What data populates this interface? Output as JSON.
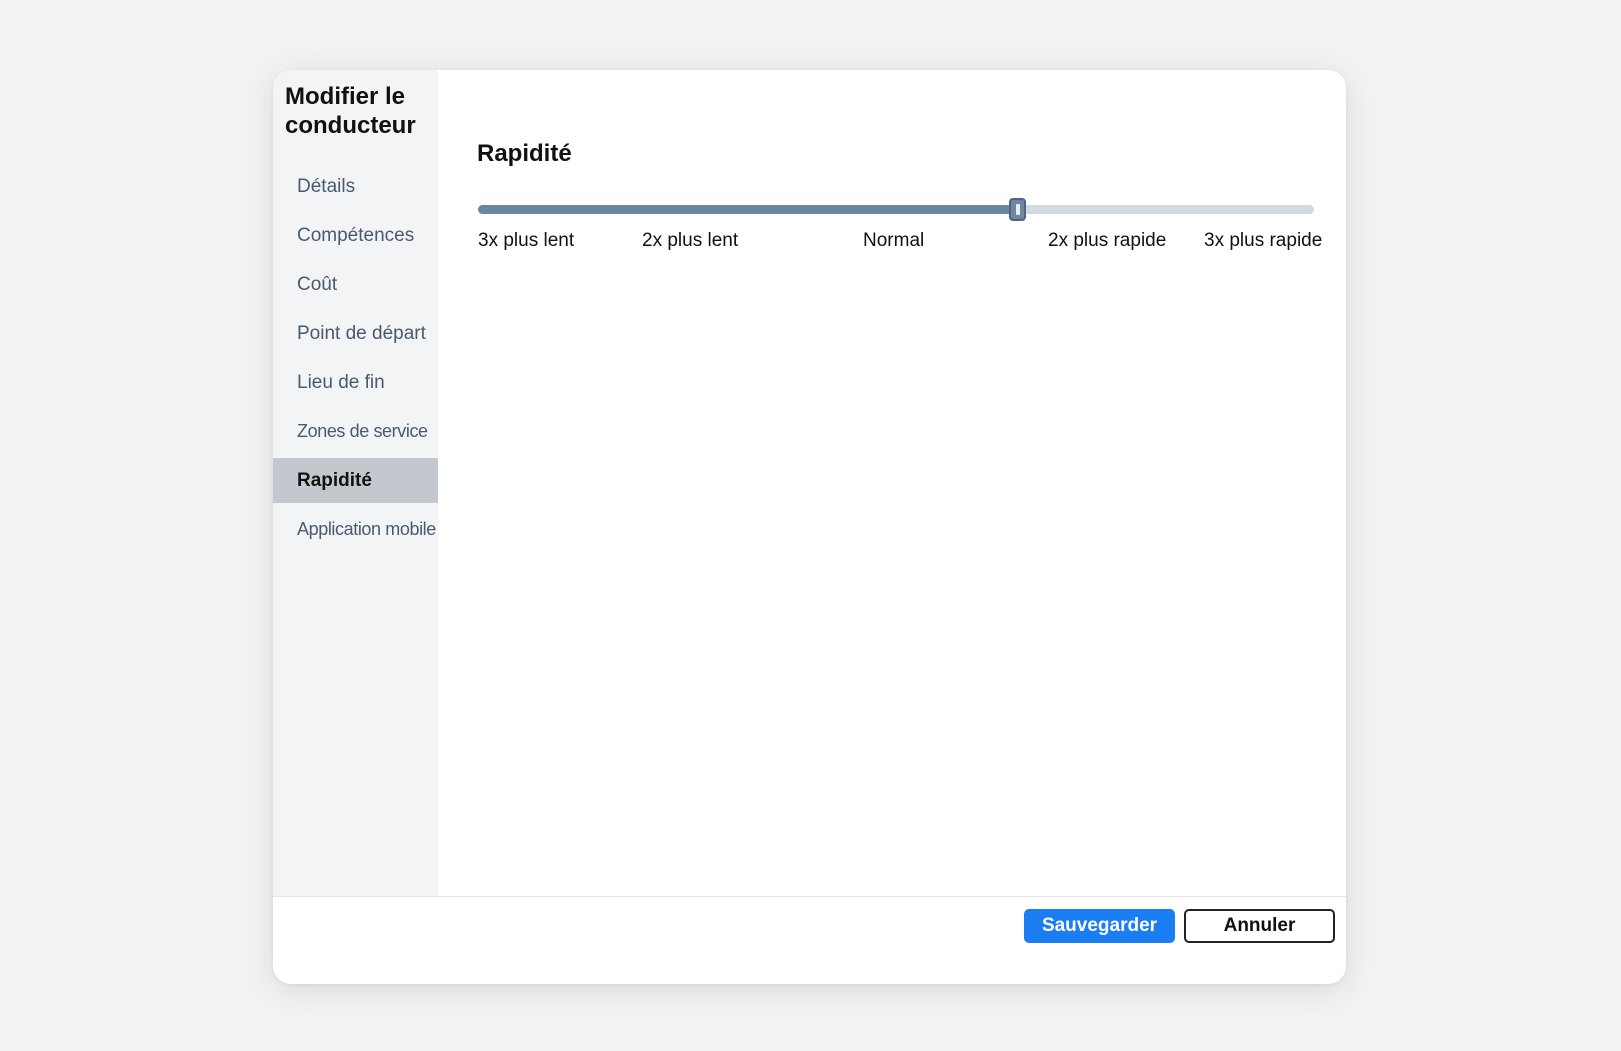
{
  "dialog": {
    "title": "Modifier le conducteur"
  },
  "sidebar": {
    "items": [
      {
        "label": "Détails"
      },
      {
        "label": "Compétences"
      },
      {
        "label": "Coût"
      },
      {
        "label": "Point de départ"
      },
      {
        "label": "Lieu de fin"
      },
      {
        "label": "Zones de service"
      },
      {
        "label": "Rapidité"
      },
      {
        "label": "Application mobile"
      }
    ],
    "active_label": "Rapidité"
  },
  "content": {
    "section_title": "Rapidité",
    "speed_slider": {
      "value_fraction": 0.645,
      "labels": [
        "3x plus lent",
        "2x plus lent",
        "Normal",
        "2x plus rapide",
        "3x plus rapide"
      ]
    }
  },
  "footer": {
    "save_label": "Sauvegarder",
    "cancel_label": "Annuler"
  },
  "colors": {
    "accent": "#1a7ef2",
    "slider_fill": "#6b86a3",
    "sidebar_active": "#c2c8ce"
  }
}
